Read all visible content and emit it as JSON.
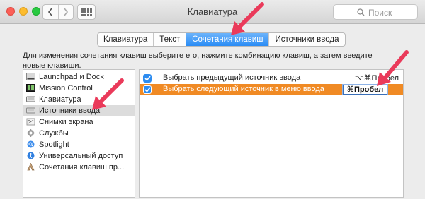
{
  "window": {
    "title": "Клавиатура"
  },
  "toolbar": {
    "search_placeholder": "Поиск"
  },
  "tabs": [
    {
      "label": "Клавиатура"
    },
    {
      "label": "Текст"
    },
    {
      "label": "Сочетания клавиш",
      "active": true
    },
    {
      "label": "Источники ввода"
    }
  ],
  "description": "Для изменения сочетания клавиш выберите его, нажмите комбинацию клавиш, а затем введите новые клавиши.",
  "sidebar": {
    "items": [
      {
        "label": "Launchpad и Dock",
        "icon": "launchpad-dock-icon"
      },
      {
        "label": "Mission Control",
        "icon": "mission-control-icon"
      },
      {
        "label": "Клавиатура",
        "icon": "keyboard-icon"
      },
      {
        "label": "Источники ввода",
        "icon": "input-sources-icon",
        "selected": true
      },
      {
        "label": "Снимки экрана",
        "icon": "screenshot-icon"
      },
      {
        "label": "Службы",
        "icon": "gear-icon"
      },
      {
        "label": "Spotlight",
        "icon": "spotlight-icon"
      },
      {
        "label": "Универсальный доступ",
        "icon": "accessibility-icon"
      },
      {
        "label": "Сочетания клавиш пр...",
        "icon": "app-shortcuts-icon"
      }
    ]
  },
  "shortcuts": [
    {
      "label": "Выбрать предыдущий источник ввода",
      "keys": "⌥⌘Пробел",
      "checked": true,
      "selected": false
    },
    {
      "label": "Выбрать следующий источник в меню ввода",
      "keys": "⌘Пробел",
      "checked": true,
      "selected": true
    }
  ],
  "colors": {
    "accent": "#2d8cf0",
    "selection": "#f08a24",
    "annotation_arrow": "#ea3a5a"
  }
}
